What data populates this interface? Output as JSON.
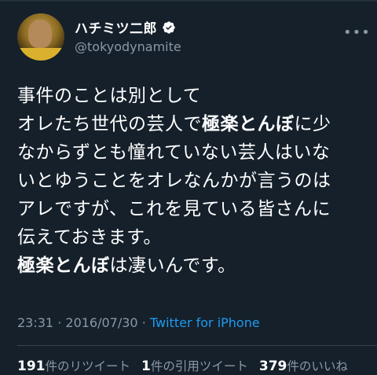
{
  "author": {
    "display_name": "ハチミツ二郎",
    "handle": "@tokyodynamite"
  },
  "more_icon": "more-horizontal-icon",
  "verified_icon": "verified-badge-icon",
  "body": {
    "line1": "事件のことは別として",
    "line2_pre": "オレたち世代の芸人で",
    "line2_bold": "極楽とんぼ",
    "line2_post": "に少",
    "line3": "なからずとも憧れていない芸人はいな",
    "line4": "いとゆうことをオレなんかが言うのは",
    "line5": "アレですが、これを見ている皆さんに",
    "line6": "伝えておきます。",
    "line7_bold": "極楽とんぼ",
    "line7_post": "は凄いんです。"
  },
  "meta": {
    "time": "23:31",
    "separator1": "·",
    "date": "2016/07/30",
    "separator2": "·",
    "source": "Twitter for iPhone"
  },
  "stats": {
    "retweets_count": "191",
    "retweets_label": "件のリツイート",
    "quotes_count": "1",
    "quotes_label": "件の引用ツイート",
    "likes_count": "379",
    "likes_label": "件のいいね"
  },
  "colors": {
    "background": "#15202b",
    "secondary_text": "#8b98a5",
    "link": "#1d9bf0"
  }
}
